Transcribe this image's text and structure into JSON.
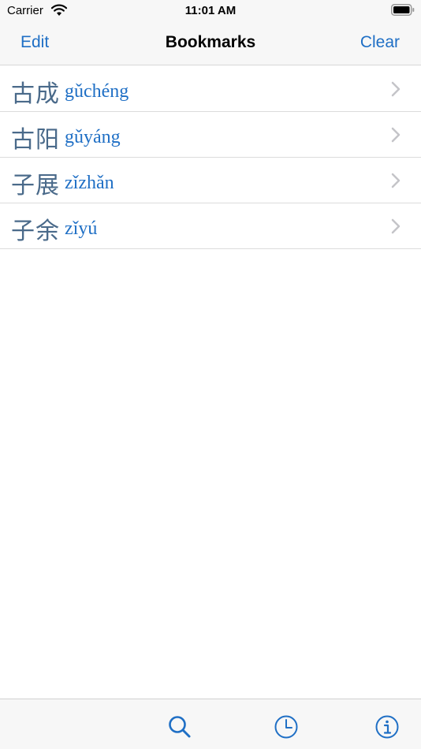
{
  "status_bar": {
    "carrier": "Carrier",
    "time": "11:01 AM",
    "icons": [
      "wifi-icon",
      "battery-icon"
    ]
  },
  "nav": {
    "title": "Bookmarks",
    "left_button": "Edit",
    "right_button": "Clear"
  },
  "bookmarks": [
    {
      "hanzi": "古成",
      "pinyin": "gǔchéng"
    },
    {
      "hanzi": "古阳",
      "pinyin": "gǔyáng"
    },
    {
      "hanzi": "子展",
      "pinyin": "zǐzhǎn"
    },
    {
      "hanzi": "子余",
      "pinyin": "zǐyú"
    }
  ],
  "tab_bar": {
    "tabs": [
      "search-icon",
      "clock-icon",
      "info-icon"
    ]
  },
  "colors": {
    "accent": "#1f6fc5",
    "hanzi": "#4a6a8a",
    "bar_background": "#f7f7f7",
    "separator": "#dcdcdc",
    "chevron": "#c4c4c8"
  }
}
